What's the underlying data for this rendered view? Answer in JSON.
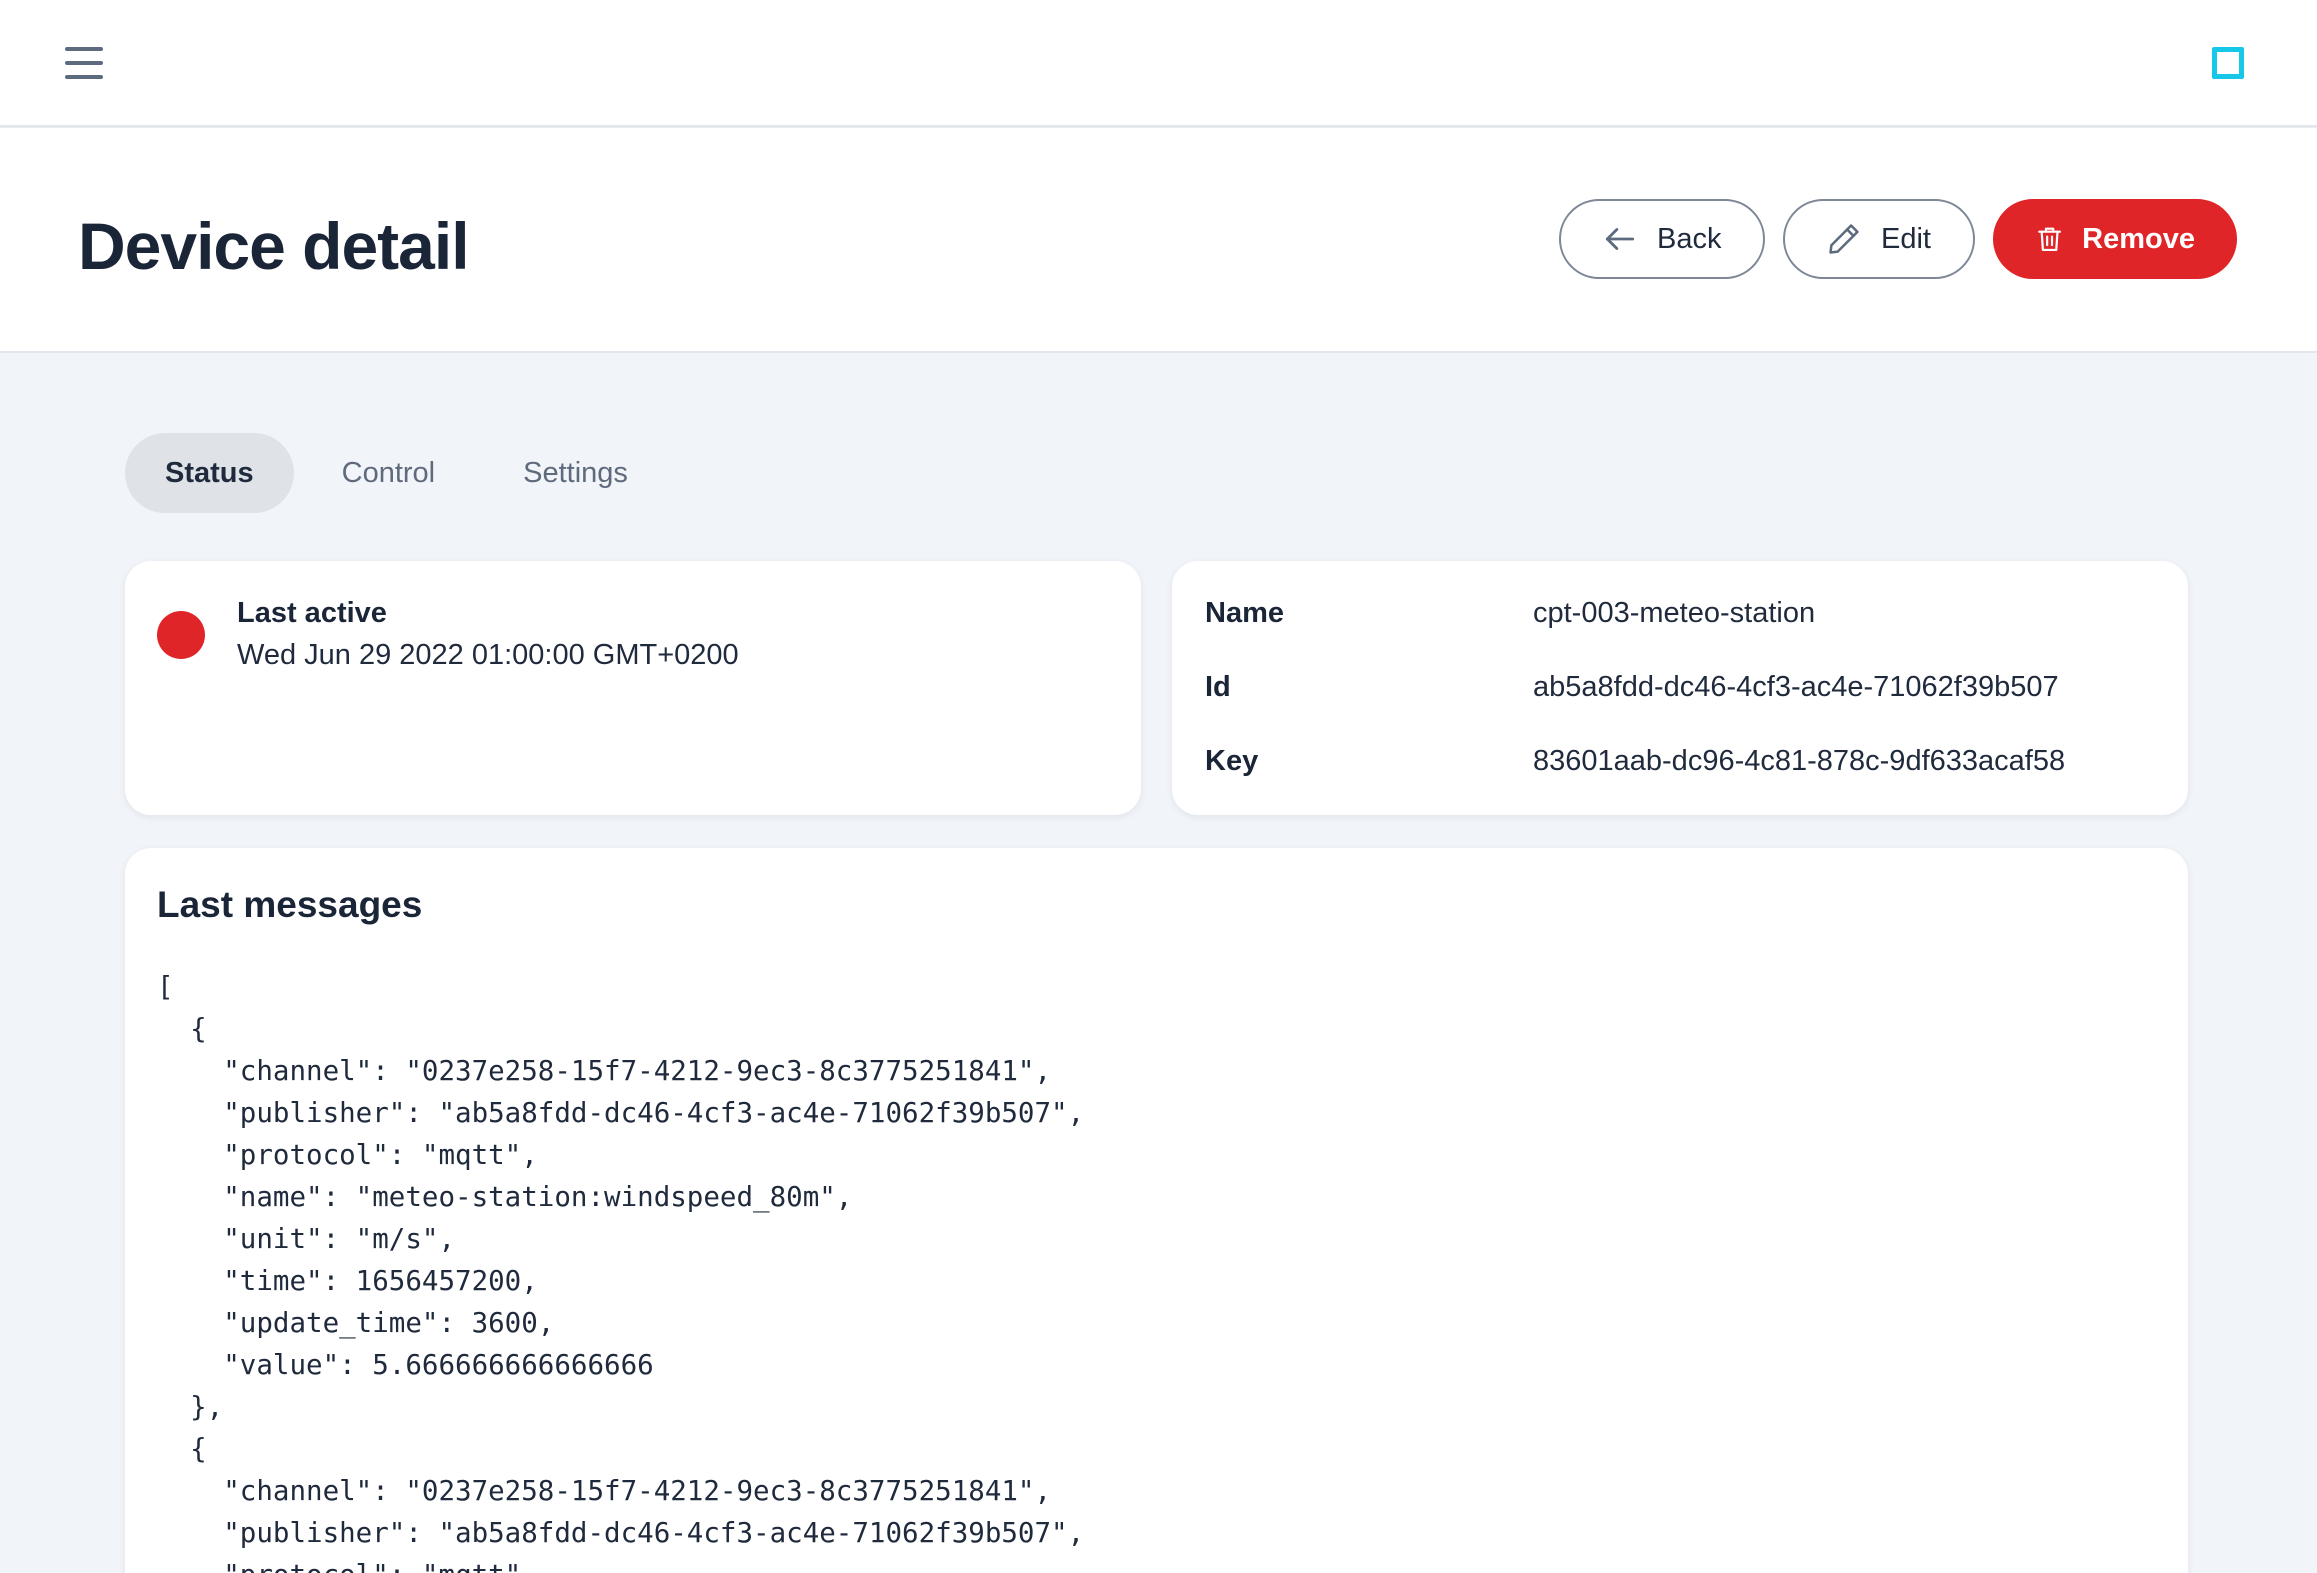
{
  "topbar": {
    "menu_icon": "hamburger-menu-icon",
    "brand_icon": "square-outline-icon",
    "brand_color": "#16c8e8"
  },
  "header": {
    "title": "Device detail",
    "actions": {
      "back_label": "Back",
      "edit_label": "Edit",
      "remove_label": "Remove"
    }
  },
  "tabs": [
    {
      "label": "Status",
      "active": true
    },
    {
      "label": "Control",
      "active": false
    },
    {
      "label": "Settings",
      "active": false
    }
  ],
  "status": {
    "label": "Last active",
    "value": "Wed Jun 29 2022 01:00:00 GMT+0200",
    "indicator_color": "#e02528"
  },
  "info": {
    "rows": [
      {
        "key": "Name",
        "value": "cpt-003-meteo-station"
      },
      {
        "key": "Id",
        "value": "ab5a8fdd-dc46-4cf3-ac4e-71062f39b507"
      },
      {
        "key": "Key",
        "value": "83601aab-dc96-4c81-878c-9df633acaf58"
      }
    ]
  },
  "messages": {
    "title": "Last messages",
    "json_text": "[\n  {\n    \"channel\": \"0237e258-15f7-4212-9ec3-8c3775251841\",\n    \"publisher\": \"ab5a8fdd-dc46-4cf3-ac4e-71062f39b507\",\n    \"protocol\": \"mqtt\",\n    \"name\": \"meteo-station:windspeed_80m\",\n    \"unit\": \"m/s\",\n    \"time\": 1656457200,\n    \"update_time\": 3600,\n    \"value\": 5.666666666666666\n  },\n  {\n    \"channel\": \"0237e258-15f7-4212-9ec3-8c3775251841\",\n    \"publisher\": \"ab5a8fdd-dc46-4cf3-ac4e-71062f39b507\",\n    \"protocol\": \"mqtt\","
  },
  "colors": {
    "accent_danger": "#e02528",
    "page_bg": "#f1f4f8"
  }
}
